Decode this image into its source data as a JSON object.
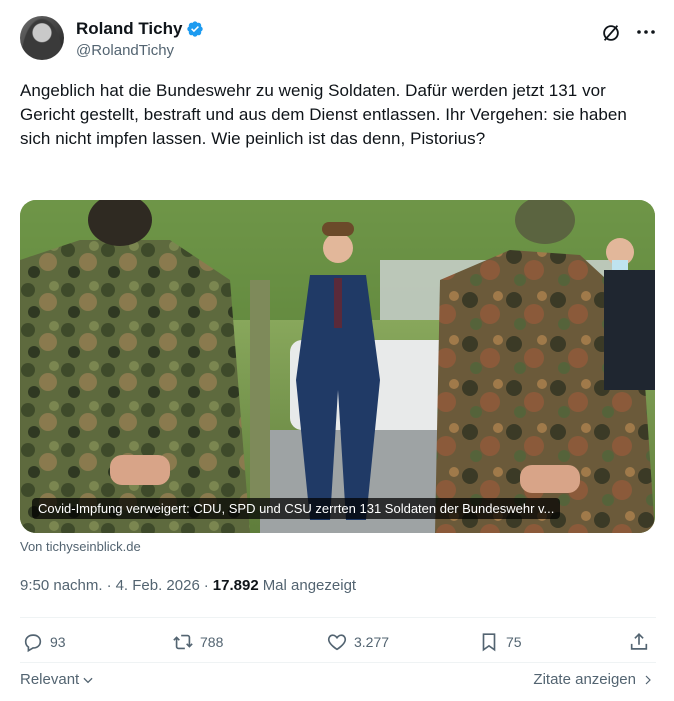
{
  "author": {
    "display_name": "Roland Tichy",
    "handle": "@RolandTichy",
    "verified_color": "#1d9bf0"
  },
  "tweet": {
    "text": "Angeblich hat die Bundeswehr zu wenig Soldaten. Dafür werden jetzt 131 vor Gericht gestellt, bestraft und aus dem Dienst entlassen. Ihr Vergehen: sie haben sich nicht impfen lassen. Wie peinlich ist das denn, Pistorius?"
  },
  "link_card": {
    "title": "Covid-Impfung verweigert: CDU, SPD und CSU zerrten 131 Soldaten der Bundeswehr v...",
    "source": "Von tichyseinblick.de"
  },
  "meta": {
    "time": "9:50 nachm.",
    "separator": "·",
    "date": "4. Feb. 2026",
    "separator2": "·",
    "views_count": "17.892",
    "views_label": "Mal angezeigt"
  },
  "actions": {
    "replies": "93",
    "reposts": "788",
    "likes": "3.277",
    "bookmarks": "75"
  },
  "footer": {
    "sort_label": "Relevant",
    "quotes_label": "Zitate anzeigen"
  },
  "icons": {
    "verified": "verified-badge-icon",
    "grok": "grok-icon",
    "more": "more-icon",
    "reply": "reply-icon",
    "repost": "repost-icon",
    "like": "like-icon",
    "bookmark": "bookmark-icon",
    "share": "share-icon"
  },
  "colors": {
    "text_primary": "#0f1419",
    "text_secondary": "#536471",
    "accent": "#1d9bf0",
    "divider": "#eff3f4"
  }
}
